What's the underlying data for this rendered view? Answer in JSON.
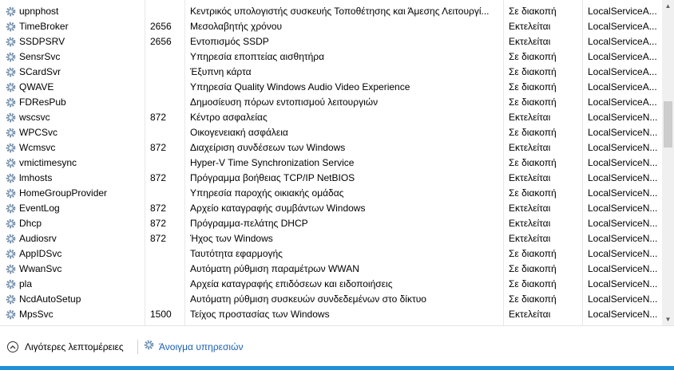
{
  "services": [
    {
      "name": "",
      "pid": "",
      "description": "",
      "status": "",
      "group": ""
    },
    {
      "name": "upnphost",
      "pid": "",
      "description": "Κεντρικός υπολογιστής συσκευής Τοποθέτησης και Άμεσης Λειτουργί...",
      "status": "Σε διακοπή",
      "group": "LocalServiceA..."
    },
    {
      "name": "TimeBroker",
      "pid": "2656",
      "description": "Μεσολαβητής χρόνου",
      "status": "Εκτελείται",
      "group": "LocalServiceA..."
    },
    {
      "name": "SSDPSRV",
      "pid": "2656",
      "description": "Εντοπισμός SSDP",
      "status": "Εκτελείται",
      "group": "LocalServiceA..."
    },
    {
      "name": "SensrSvc",
      "pid": "",
      "description": "Υπηρεσία εποπτείας αισθητήρα",
      "status": "Σε διακοπή",
      "group": "LocalServiceA..."
    },
    {
      "name": "SCardSvr",
      "pid": "",
      "description": "Έξυπνη κάρτα",
      "status": "Σε διακοπή",
      "group": "LocalServiceA..."
    },
    {
      "name": "QWAVE",
      "pid": "",
      "description": "Υπηρεσία Quality Windows Audio Video Experience",
      "status": "Σε διακοπή",
      "group": "LocalServiceA..."
    },
    {
      "name": "FDResPub",
      "pid": "",
      "description": "Δημοσίευση πόρων εντοπισμού λειτουργιών",
      "status": "Σε διακοπή",
      "group": "LocalServiceA..."
    },
    {
      "name": "wscsvc",
      "pid": "872",
      "description": "Κέντρο ασφαλείας",
      "status": "Εκτελείται",
      "group": "LocalServiceN..."
    },
    {
      "name": "WPCSvc",
      "pid": "",
      "description": "Οικογενειακή ασφάλεια",
      "status": "Σε διακοπή",
      "group": "LocalServiceN..."
    },
    {
      "name": "Wcmsvc",
      "pid": "872",
      "description": "Διαχείριση συνδέσεων των Windows",
      "status": "Εκτελείται",
      "group": "LocalServiceN..."
    },
    {
      "name": "vmictimesync",
      "pid": "",
      "description": "Hyper-V Time Synchronization Service",
      "status": "Σε διακοπή",
      "group": "LocalServiceN..."
    },
    {
      "name": "lmhosts",
      "pid": "872",
      "description": "Πρόγραμμα βοήθειας TCP/IP NetBIOS",
      "status": "Εκτελείται",
      "group": "LocalServiceN..."
    },
    {
      "name": "HomeGroupProvider",
      "pid": "",
      "description": "Υπηρεσία παροχής οικιακής ομάδας",
      "status": "Σε διακοπή",
      "group": "LocalServiceN..."
    },
    {
      "name": "EventLog",
      "pid": "872",
      "description": "Αρχείο καταγραφής συμβάντων Windows",
      "status": "Εκτελείται",
      "group": "LocalServiceN..."
    },
    {
      "name": "Dhcp",
      "pid": "872",
      "description": "Πρόγραμμα-πελάτης DHCP",
      "status": "Εκτελείται",
      "group": "LocalServiceN..."
    },
    {
      "name": "Audiosrv",
      "pid": "872",
      "description": "Ήχος των Windows",
      "status": "Εκτελείται",
      "group": "LocalServiceN..."
    },
    {
      "name": "AppIDSvc",
      "pid": "",
      "description": "Ταυτότητα εφαρμογής",
      "status": "Σε διακοπή",
      "group": "LocalServiceN..."
    },
    {
      "name": "WwanSvc",
      "pid": "",
      "description": "Αυτόματη ρύθμιση παραμέτρων WWAN",
      "status": "Σε διακοπή",
      "group": "LocalServiceN..."
    },
    {
      "name": "pla",
      "pid": "",
      "description": "Αρχεία καταγραφής επιδόσεων και ειδοποιήσεις",
      "status": "Σε διακοπή",
      "group": "LocalServiceN..."
    },
    {
      "name": "NcdAutoSetup",
      "pid": "",
      "description": "Αυτόματη ρύθμιση συσκευών συνδεδεμένων στο δίκτυο",
      "status": "Σε διακοπή",
      "group": "LocalServiceN..."
    },
    {
      "name": "MpsSvc",
      "pid": "1500",
      "description": "Τείχος προστασίας των Windows",
      "status": "Εκτελείται",
      "group": "LocalServiceN..."
    },
    {
      "name": "",
      "pid": "",
      "description": "",
      "status": "",
      "group": ""
    }
  ],
  "footer": {
    "less_details_label": "Λιγότερες λεπτομέρειες",
    "open_services_label": "Άνοιγμα υπηρεσιών"
  },
  "colors": {
    "link": "#1a5fb4",
    "accent": "#1e90d6"
  }
}
